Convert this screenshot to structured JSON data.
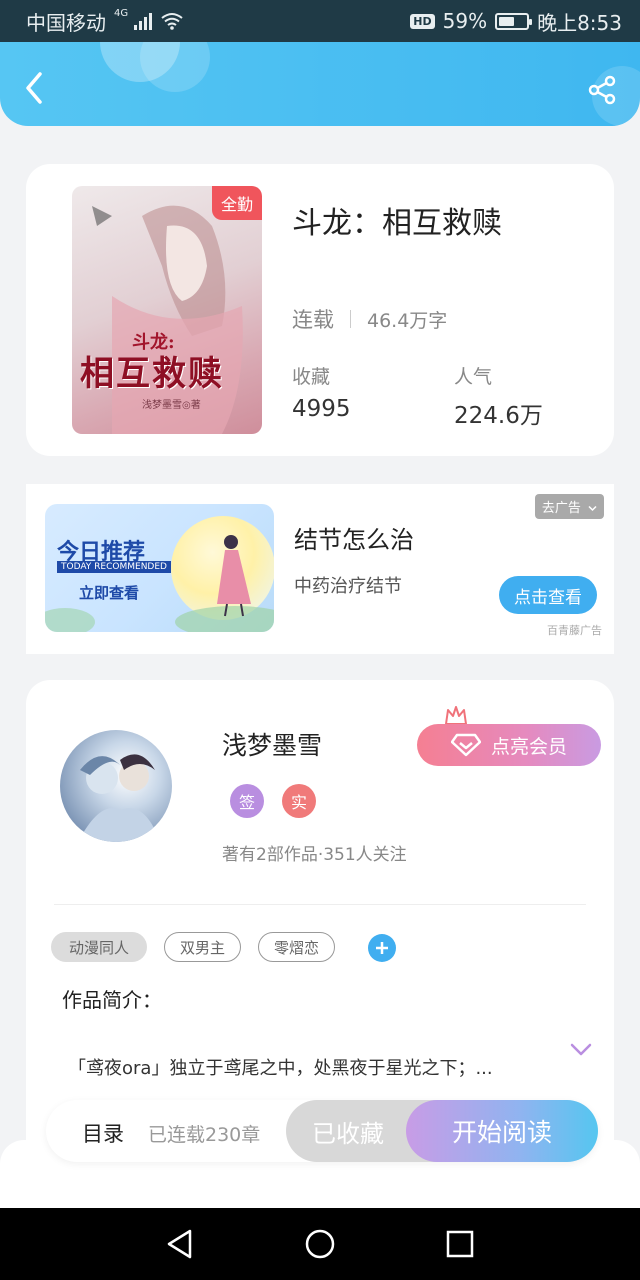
{
  "status_bar": {
    "carrier": "中国移动",
    "network": "4G",
    "hd": "HD",
    "battery_percent": "59%",
    "battery_level": 0.59,
    "time": "晚上8:53"
  },
  "header": {
    "back_icon": "chevron-left-icon",
    "share_icon": "share-icon",
    "color": "#46bdf1"
  },
  "book": {
    "cover_badge": "全勤",
    "cover_title_small": "斗龙:",
    "cover_title": "相互救赎",
    "cover_author": "浅梦墨雪◎著",
    "title": "斗龙：相互救赎",
    "status": "连载",
    "words": "46.4万字",
    "collect_label": "收藏",
    "collect_value": "4995",
    "popularity_label": "人气",
    "popularity_value": "224.6万"
  },
  "ad": {
    "banner_heading": "今日推荐",
    "banner_sub": "TODAY RECOMMENDED",
    "banner_cta": "立即查看",
    "title": "结节怎么治",
    "description": "中药治疗结节",
    "remove_label": "去广告",
    "view_label": "点击查看",
    "source": "百青藤广告"
  },
  "author": {
    "name": "浅梦墨雪",
    "badge_sign": "签",
    "badge_real": "实",
    "meta": "著有2部作品·351人关注",
    "vip_label": "点亮会员",
    "tags": [
      "动漫同人",
      "双男主",
      "零熠恋"
    ],
    "synopsis_label": "作品简介：",
    "synopsis": "「鸢夜ora」独立于鸢尾之中，处黑夜于星光之下；..."
  },
  "action_bar": {
    "toc_label": "目录",
    "chapters_label": "已连载230章",
    "collected_label": "已收藏",
    "read_label": "开始阅读"
  },
  "colors": {
    "accent": "#40aef0",
    "badge_sign": "#b98ee0",
    "badge_real": "#f07a7a"
  }
}
